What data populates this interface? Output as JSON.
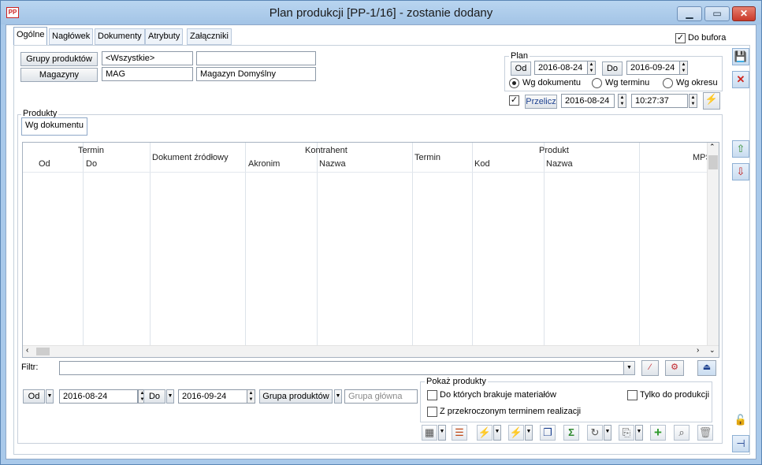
{
  "window": {
    "title": "Plan produkcji [PP-1/16] - zostanie dodany",
    "app_icon": "PP"
  },
  "tabs": [
    "Ogólne",
    "Nagłówek",
    "Dokumenty",
    "Atrybuty",
    "Załączniki"
  ],
  "active_tab": "Ogólne",
  "do_bufora": {
    "label": "Do bufora",
    "checked": true
  },
  "filters": {
    "grupy_button": "Grupy produktów",
    "grupy_value": "<Wszystkie>",
    "grupy_desc": "",
    "magazyny_button": "Magazyny",
    "magazyn_code": "MAG",
    "magazyn_name": "Magazyn Domyślny"
  },
  "plan": {
    "legend": "Plan",
    "od_label": "Od",
    "od_date": "2016-08-24",
    "do_label": "Do",
    "do_date": "2016-09-24",
    "options": [
      "Wg dokumentu",
      "Wg terminu",
      "Wg okresu"
    ],
    "selected": "Wg dokumentu",
    "przelicz_checked": true,
    "przelicz_label": "Przelicz",
    "przelicz_date": "2016-08-24",
    "przelicz_time": "10:27:37"
  },
  "produkty": {
    "legend": "Produkty",
    "subtab": "Wg dokumentu",
    "grid": {
      "group_headers": [
        "Termin",
        "Kontrahent",
        "Produkt"
      ],
      "columns": [
        "Od",
        "Do",
        "Dokument źródłowy",
        "Akronim",
        "Nazwa",
        "Termin",
        "Kod",
        "Nazwa",
        "MPS"
      ],
      "rows": []
    }
  },
  "filtr": {
    "label": "Filtr:",
    "value": ""
  },
  "bottom": {
    "od_label": "Od",
    "od_date": "2016-08-24",
    "do_label": "Do",
    "do_date": "2016-09-24",
    "grupa_button": "Grupa produktów",
    "grupa_value": "Grupa główna",
    "pokaz_legend": "Pokaż produkty",
    "pokaz_options": [
      {
        "label": "Do których brakuje materiałów",
        "checked": false
      },
      {
        "label": "Z przekroczonym terminem realizacji",
        "checked": false
      },
      {
        "label": "Tylko do produkcji",
        "checked": false
      }
    ]
  },
  "toolbar_icons": [
    "grid-settings-icon",
    "columns-icon",
    "lightning-orange-icon",
    "lightning-green-icon",
    "document-icon",
    "sigma-icon",
    "magnet-icon",
    "export-icon",
    "add-icon",
    "search-icon",
    "delete-icon"
  ],
  "side_icons": [
    "save-icon",
    "cancel-icon",
    "upload-icon",
    "download-icon",
    "lock-icon",
    "pin-icon"
  ]
}
